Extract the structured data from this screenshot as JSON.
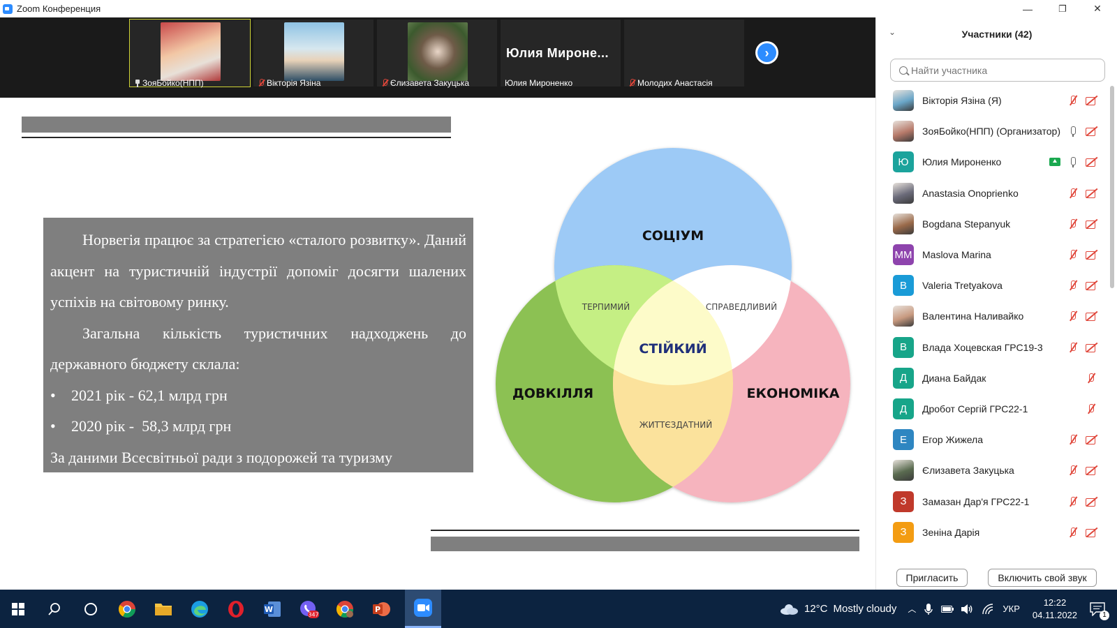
{
  "window": {
    "title": "Zoom Конференция",
    "controls": [
      "—",
      "❐",
      "✕"
    ]
  },
  "thumbnails": [
    {
      "name": "ЗояБойко(НПП)",
      "status": "pinned",
      "video": true,
      "active": true
    },
    {
      "name": "Вікторія Язіна",
      "status": "muted",
      "video": true,
      "active": false
    },
    {
      "name": "Єлизавета Закуцька",
      "status": "muted",
      "video": true,
      "active": false
    },
    {
      "name": "Юлия Мироненко",
      "big_name": "Юлия Мироне...",
      "status": "none",
      "video": false,
      "active": false
    },
    {
      "name": "Молодих Анастасія",
      "status": "muted",
      "video": false,
      "active": false
    }
  ],
  "slide": {
    "paragraph1": "Норвегія працює за стратегією «сталого розвитку». Даний акцент на туристичній індустрії допоміг досягти шалених успіхів на світовому ринку.",
    "paragraph2": "Загальна кількість туристичних надходжень до державного бюджету склала:",
    "bullets": [
      "2021 рік - 62,1 млрд грн",
      "2020 рік -  58,3 млрд грн"
    ],
    "source": "За даними Всесвітньої ради з подорожей та туризму",
    "venn": {
      "top": "СОЦІУМ",
      "left": "ДОВКІЛЛЯ",
      "right": "ЕКОНОМІКА",
      "center": "СТІЙКИЙ",
      "top_left": "ТЕРПИМИЙ",
      "top_right": "СПРАВЕДЛИВИЙ",
      "bottom": "ЖИТТЄЗДАТНИЙ",
      "colors": {
        "top": "#9dcaf6",
        "left": "#8cc152",
        "right": "#f6b4be",
        "top_left": "#c5ef84",
        "top_right": "#ffffff",
        "bottom": "#fbe29c",
        "center": "#fdfbc9"
      }
    }
  },
  "panel": {
    "title": "Участники (42)",
    "search_placeholder": "Найти участника",
    "participants": [
      {
        "name": "Вікторія Язіна (Я)",
        "avatar": "photo",
        "color": "#6aa6c8",
        "mic": "muted",
        "cam": "off"
      },
      {
        "name": "ЗояБойко(НПП) (Организатор)",
        "avatar": "photo",
        "color": "#b77a6a",
        "mic": "on",
        "cam": "off"
      },
      {
        "name": "Юлия Мироненко",
        "avatar": "Ю",
        "color": "#1ba39c",
        "mic": "on",
        "cam": "off",
        "sharing": true
      },
      {
        "name": "Anastasia Onoprienko",
        "avatar": "photo",
        "color": "#6b6b7a",
        "mic": "muted",
        "cam": "off"
      },
      {
        "name": "Bogdana Stepanyuk",
        "avatar": "photo",
        "color": "#9a6a4a",
        "mic": "muted",
        "cam": "off"
      },
      {
        "name": "Maslova Marina",
        "avatar": "ММ",
        "color": "#8e44ad",
        "mic": "muted",
        "cam": "off"
      },
      {
        "name": "Valeria Tretyakova",
        "avatar": "B",
        "color": "#1a9bd7",
        "mic": "muted",
        "cam": "off"
      },
      {
        "name": "Валентина Наливайко",
        "avatar": "photo",
        "color": "#c89a80",
        "mic": "muted",
        "cam": "off"
      },
      {
        "name": "Влада Хоцевская ГРС19-3",
        "avatar": "В",
        "color": "#17a589",
        "mic": "muted",
        "cam": "off"
      },
      {
        "name": "Диана Байдак",
        "avatar": "Д",
        "color": "#17a589",
        "mic": "muted",
        "cam": "none"
      },
      {
        "name": "Дробот Сергій ГРС22-1",
        "avatar": "Д",
        "color": "#17a589",
        "mic": "muted",
        "cam": "none"
      },
      {
        "name": "Егор Жижела",
        "avatar": "Е",
        "color": "#2e86c1",
        "mic": "muted",
        "cam": "off"
      },
      {
        "name": "Єлизавета Закуцька",
        "avatar": "photo",
        "color": "#5a6b50",
        "mic": "muted",
        "cam": "off"
      },
      {
        "name": "Замазан Дар'я ГРС22-1",
        "avatar": "З",
        "color": "#c0392b",
        "mic": "muted",
        "cam": "off"
      },
      {
        "name": "Зеніна Дарія",
        "avatar": "З",
        "color": "#f39c12",
        "mic": "muted",
        "cam": "off"
      }
    ],
    "invite_label": "Пригласить",
    "unmute_label": "Включить свой звук"
  },
  "taskbar": {
    "weather_temp": "12°C",
    "weather_text": "Mostly cloudy",
    "lang": "УКР",
    "time": "12:22",
    "date": "04.11.2022",
    "notif_count": "1",
    "viber_badge": "347"
  }
}
